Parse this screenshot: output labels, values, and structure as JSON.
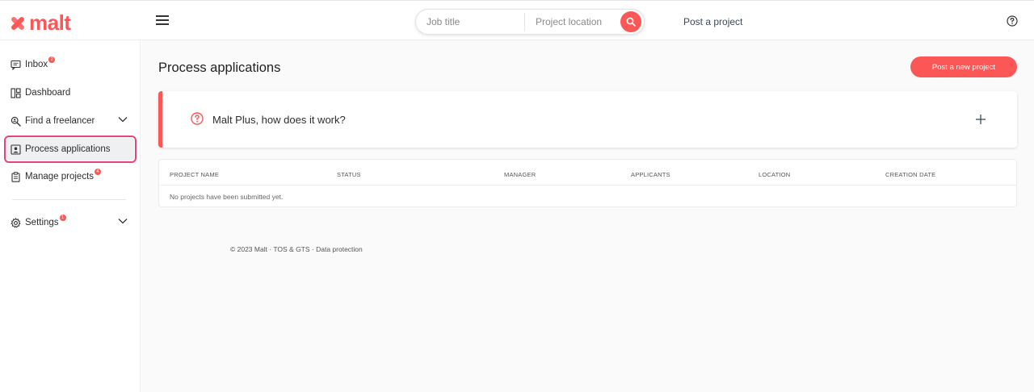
{
  "brand": {
    "name": "malt",
    "color": "#fc5757"
  },
  "header": {
    "search": {
      "job_title_placeholder": "Job title",
      "location_placeholder": "Project location"
    },
    "post_project_link": "Post a project"
  },
  "sidebar": {
    "items": [
      {
        "label": "Inbox",
        "icon": "chat-icon",
        "badge": "2"
      },
      {
        "label": "Dashboard",
        "icon": "dashboard-icon"
      },
      {
        "label": "Find a freelancer",
        "icon": "search-person-icon"
      },
      {
        "label": "Process applications",
        "icon": "applications-icon",
        "active": true
      },
      {
        "label": "Manage projects",
        "icon": "clipboard-icon",
        "badge": "4"
      },
      {
        "label": "Settings",
        "icon": "gear-icon",
        "badge": "1"
      }
    ]
  },
  "main": {
    "title": "Process applications",
    "post_button": "Post a new project",
    "faq": {
      "title": "Malt Plus, how does it work?"
    },
    "table": {
      "columns": [
        "PROJECT NAME",
        "STATUS",
        "MANAGER",
        "APPLICANTS",
        "LOCATION",
        "CREATION DATE"
      ],
      "empty_message": "No projects have been submitted yet."
    },
    "footer": {
      "copyright": "© 2023 Malt",
      "separator": " · ",
      "links": [
        "TOS & GTS",
        "Data protection"
      ]
    }
  }
}
